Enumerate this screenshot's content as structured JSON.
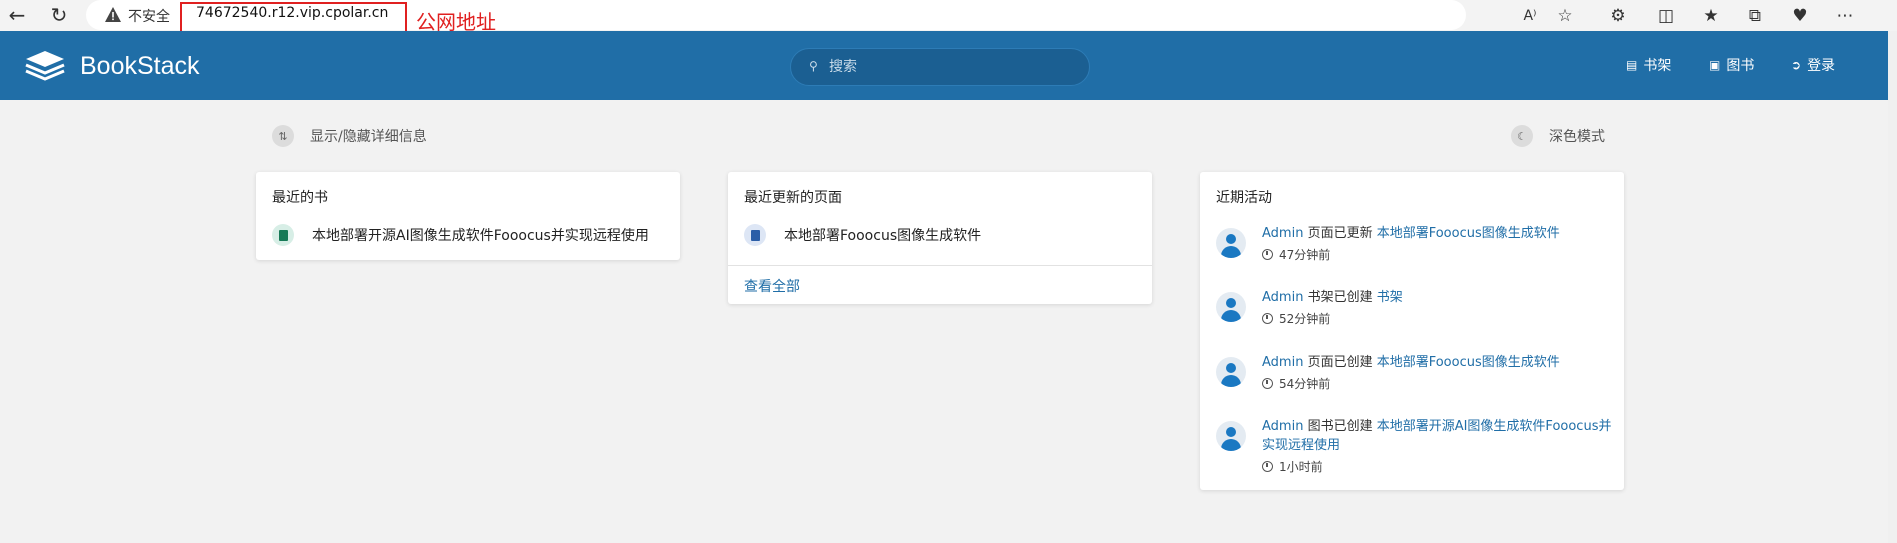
{
  "browser": {
    "insecure_label": "不安全",
    "url": "74672540.r12.vip.cpolar.cn",
    "annotation": "公网地址",
    "reader_label": "A⁾"
  },
  "header": {
    "brand": "BookStack",
    "search_placeholder": "搜索",
    "nav": [
      {
        "label": "书架",
        "icon": "shelves-icon"
      },
      {
        "label": "图书",
        "icon": "book-icon"
      },
      {
        "label": "登录",
        "icon": "login-icon"
      }
    ]
  },
  "actions": {
    "toggle_details": "显示/隐藏详细信息",
    "dark_mode": "深色模式"
  },
  "recent_books": {
    "title": "最近的书",
    "items": [
      "本地部署开源AI图像生成软件Fooocus并实现远程使用"
    ]
  },
  "recent_pages": {
    "title": "最近更新的页面",
    "items": [
      "本地部署Fooocus图像生成软件"
    ],
    "view_all": "查看全部"
  },
  "activity": {
    "title": "近期活动",
    "items": [
      {
        "user": "Admin",
        "action": " 页面已更新 ",
        "target": "本地部署Fooocus图像生成软件",
        "time": "47分钟前"
      },
      {
        "user": "Admin",
        "action": " 书架已创建 ",
        "target": "书架",
        "time": "52分钟前"
      },
      {
        "user": "Admin",
        "action": " 页面已创建 ",
        "target": "本地部署Fooocus图像生成软件",
        "time": "54分钟前"
      },
      {
        "user": "Admin",
        "action": " 图书已创建 ",
        "target": "本地部署开源AI图像生成软件Fooocus并实现远程使用",
        "time": "1小时前"
      }
    ]
  },
  "colors": {
    "header": "#206ea7",
    "link": "#206ea7",
    "annotation": "#e02020"
  }
}
